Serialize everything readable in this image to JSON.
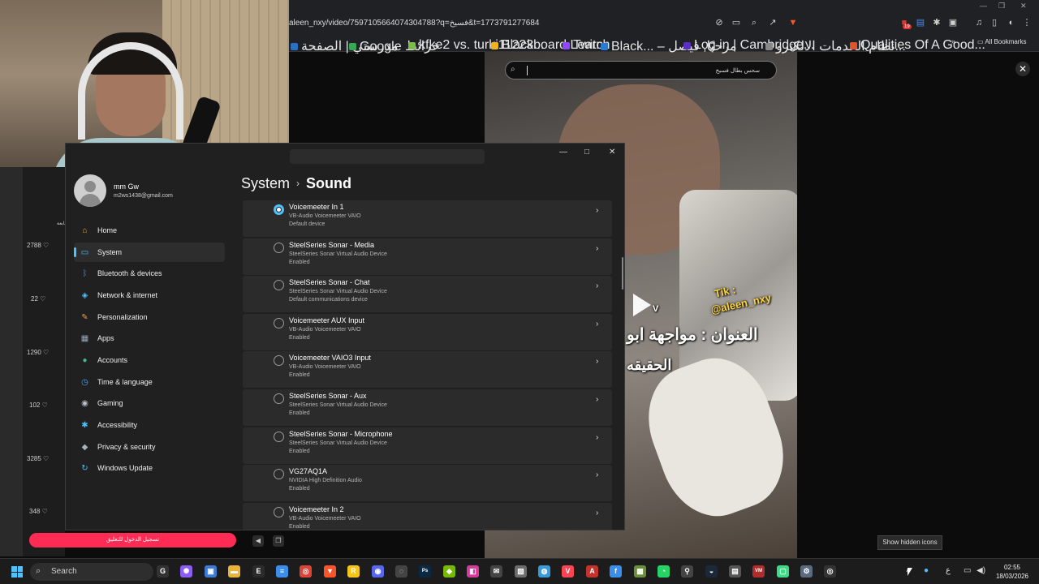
{
  "browser": {
    "url": "aleen_nxy/video/7597105664074304788?q=فسيخ&t=1773791277684",
    "bookmarks": [
      {
        "label": "مدرستي | الصفحة",
        "color": "#2a6fc2"
      },
      {
        "label": "Google خرائط",
        "color": "#34a853"
      },
      {
        "label": "kfke2 vs. turki11223...",
        "color": "#7cbd4a"
      },
      {
        "label": "Blackboard Learn",
        "color": "#f2b21b"
      },
      {
        "label": "Twitch",
        "color": "#9146ff"
      },
      {
        "label": "Black... – مرحبًا, فيصل",
        "color": "#2b7bd6"
      },
      {
        "label": "Log in | Cambridge...",
        "color": "#5a2fc2"
      },
      {
        "label": "نظام الخدمات الالكترو...",
        "color": "#888888"
      },
      {
        "label": "Qualities Of A Good...",
        "color": "#e0542c"
      }
    ],
    "all_bookmarks": "All Bookmarks",
    "ext_badge": "19"
  },
  "left_panel": {
    "counts": [
      "2788",
      "22",
      "1290",
      "102",
      "3285",
      "348"
    ],
    "top_text": "متابعة"
  },
  "video": {
    "search_query": "سحس بطال فسيخ",
    "watermark_tik": "Tik :",
    "watermark_handle": "@aleen_nxy",
    "title_line1": "العنوان : مواجهة ابو",
    "title_line2": "الحقيقه",
    "play_label": "V",
    "close": "✕"
  },
  "tooltip": "Show hidden icons",
  "login_bar": "تسجيل الدخول للتعليق",
  "settings": {
    "profile_name": "mm Gw",
    "profile_email": "m2ws1438@gmail.com",
    "breadcrumb_parent": "System",
    "breadcrumb_current": "Sound",
    "nav": [
      {
        "label": "Home",
        "icon": "home-icon",
        "glyph": "⌂",
        "color": "#e8a44a",
        "active": false
      },
      {
        "label": "System",
        "icon": "system-icon",
        "glyph": "▭",
        "color": "#4cc2ff",
        "active": true
      },
      {
        "label": "Bluetooth & devices",
        "icon": "bluetooth-icon",
        "glyph": "ᛒ",
        "color": "#3b8eea",
        "active": false
      },
      {
        "label": "Network & internet",
        "icon": "network-icon",
        "glyph": "◈",
        "color": "#4cc2ff",
        "active": false
      },
      {
        "label": "Personalization",
        "icon": "personalization-icon",
        "glyph": "✎",
        "color": "#e6a04b",
        "active": false
      },
      {
        "label": "Apps",
        "icon": "apps-icon",
        "glyph": "▦",
        "color": "#9aa8ba",
        "active": false
      },
      {
        "label": "Accounts",
        "icon": "accounts-icon",
        "glyph": "●",
        "color": "#3fb68b",
        "active": false
      },
      {
        "label": "Time & language",
        "icon": "time-language-icon",
        "glyph": "◷",
        "color": "#4aa3e8",
        "active": false
      },
      {
        "label": "Gaming",
        "icon": "gaming-icon",
        "glyph": "◉",
        "color": "#b9c0c9",
        "active": false
      },
      {
        "label": "Accessibility",
        "icon": "accessibility-icon",
        "glyph": "✱",
        "color": "#4cc2ff",
        "active": false
      },
      {
        "label": "Privacy & security",
        "icon": "shield-icon",
        "glyph": "◆",
        "color": "#a8b0ba",
        "active": false
      },
      {
        "label": "Windows Update",
        "icon": "windows-update-icon",
        "glyph": "↻",
        "color": "#4cc2ff",
        "active": false
      }
    ],
    "devices": [
      {
        "name": "Voicemeeter In 1",
        "driver": "VB-Audio Voicemeeter VAIO",
        "state": "Default device",
        "selected": true
      },
      {
        "name": "SteelSeries Sonar - Media",
        "driver": "SteelSeries Sonar Virtual Audio Device",
        "state": "Enabled",
        "selected": false
      },
      {
        "name": "SteelSeries Sonar - Chat",
        "driver": "SteelSeries Sonar Virtual Audio Device",
        "state": "Default communications device",
        "selected": false
      },
      {
        "name": "Voicemeeter AUX Input",
        "driver": "VB-Audio Voicemeeter VAIO",
        "state": "Enabled",
        "selected": false
      },
      {
        "name": "Voicemeeter VAIO3 Input",
        "driver": "VB-Audio Voicemeeter VAIO",
        "state": "Enabled",
        "selected": false
      },
      {
        "name": "SteelSeries Sonar - Aux",
        "driver": "SteelSeries Sonar Virtual Audio Device",
        "state": "Enabled",
        "selected": false
      },
      {
        "name": "SteelSeries Sonar - Microphone",
        "driver": "SteelSeries Sonar Virtual Audio Device",
        "state": "Enabled",
        "selected": false
      },
      {
        "name": "VG27AQ1A",
        "driver": "NVIDIA High Definition Audio",
        "state": "Enabled",
        "selected": false
      },
      {
        "name": "Voicemeeter In 2",
        "driver": "VB-Audio Voicemeeter VAIO",
        "state": "Enabled",
        "selected": false
      }
    ]
  },
  "taskbar": {
    "search_label": "Search",
    "apps": [
      {
        "icon": "game-app-icon",
        "glyph": "G",
        "color": "#333333"
      },
      {
        "icon": "pinwheel-app-icon",
        "glyph": "✺",
        "color": "#8b5cf6"
      },
      {
        "icon": "store-icon",
        "glyph": "▣",
        "color": "#3a7bd5"
      },
      {
        "icon": "file-explorer-icon",
        "glyph": "▬",
        "color": "#e8b43a"
      },
      {
        "icon": "epic-games-icon",
        "glyph": "E",
        "color": "#2b2b2b"
      },
      {
        "icon": "notepad-icon",
        "glyph": "≡",
        "color": "#3b8eea"
      },
      {
        "icon": "chrome-icon",
        "glyph": "◎",
        "color": "#db4437"
      },
      {
        "icon": "brave-icon",
        "glyph": "▼",
        "color": "#fb542b"
      },
      {
        "icon": "audacity-icon",
        "glyph": "R",
        "color": "#f5c518"
      },
      {
        "icon": "discord-icon",
        "glyph": "◉",
        "color": "#5865f2"
      },
      {
        "icon": "obs-icon",
        "glyph": "◌",
        "color": "#444444"
      },
      {
        "icon": "photoshop-icon",
        "glyph": "Ps",
        "color": "#0a2a44"
      },
      {
        "icon": "nvidia-icon",
        "glyph": "◆",
        "color": "#76b900"
      },
      {
        "icon": "app-purple-icon",
        "glyph": "◧",
        "color": "#d63b9a"
      },
      {
        "icon": "mail-icon",
        "glyph": "✉",
        "color": "#444444"
      },
      {
        "icon": "image-app-icon",
        "glyph": "▧",
        "color": "#6d6d6d"
      },
      {
        "icon": "earth-app-icon",
        "glyph": "◍",
        "color": "#3a9ad9"
      },
      {
        "icon": "valorant-icon",
        "glyph": "V",
        "color": "#fa4454"
      },
      {
        "icon": "apex-icon",
        "glyph": "A",
        "color": "#c4322c"
      },
      {
        "icon": "file-app-icon",
        "glyph": "f",
        "color": "#3b8eea"
      },
      {
        "icon": "minecraft-icon",
        "glyph": "▩",
        "color": "#6a8f3a"
      },
      {
        "icon": "whatsapp-icon",
        "glyph": "◔",
        "color": "#25d366"
      },
      {
        "icon": "cs-icon",
        "glyph": "⚲",
        "color": "#444444"
      },
      {
        "icon": "steam-icon",
        "glyph": "◒",
        "color": "#1b2838"
      },
      {
        "icon": "cpu-app-icon",
        "glyph": "▤",
        "color": "#555555"
      },
      {
        "icon": "voicemeeter-icon",
        "glyph": "VM",
        "color": "#b32c2c"
      },
      {
        "icon": "android-icon",
        "glyph": "▢",
        "color": "#3ddc84"
      },
      {
        "icon": "settings-app-icon",
        "glyph": "⚙",
        "color": "#5a6b80"
      },
      {
        "icon": "steelseries-icon",
        "glyph": "◎",
        "color": "#333333"
      }
    ],
    "time": "02:55",
    "date": "18/03/2026",
    "lang": "ع"
  }
}
